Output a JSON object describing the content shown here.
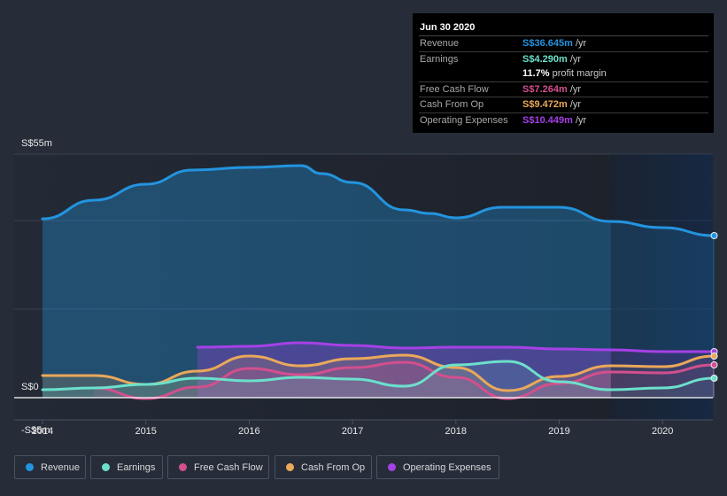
{
  "tooltip": {
    "date": "Jun 30 2020",
    "rows": [
      {
        "label": "Revenue",
        "value": "S$36.645m",
        "unit": " /yr",
        "color": "#2394df"
      },
      {
        "label": "Earnings",
        "value": "S$4.290m",
        "unit": " /yr",
        "color": "#6ce0cb"
      },
      {
        "label": "",
        "value": "11.7%",
        "unit": " profit margin",
        "color": "#ffffff"
      },
      {
        "label": "Free Cash Flow",
        "value": "S$7.264m",
        "unit": " /yr",
        "color": "#d34f8e"
      },
      {
        "label": "Cash From Op",
        "value": "S$9.472m",
        "unit": " /yr",
        "color": "#eaa85a"
      },
      {
        "label": "Operating Expenses",
        "value": "S$10.449m",
        "unit": " /yr",
        "color": "#a541e6"
      }
    ]
  },
  "legend": [
    {
      "label": "Revenue",
      "color": "#2394df"
    },
    {
      "label": "Earnings",
      "color": "#6ce0cb"
    },
    {
      "label": "Free Cash Flow",
      "color": "#d34f8e"
    },
    {
      "label": "Cash From Op",
      "color": "#eaa85a"
    },
    {
      "label": "Operating Expenses",
      "color": "#a541e6"
    }
  ],
  "chart_data": {
    "type": "area",
    "title": "",
    "xlabel": "",
    "ylabel": "",
    "currency_unit": "S$m",
    "ylim": [
      -5,
      55
    ],
    "xlim": [
      2013.7,
      2020.5
    ],
    "y_tick_labels": [
      {
        "value": 55,
        "label": "S$55m"
      },
      {
        "value": 0,
        "label": "S$0"
      },
      {
        "value": -5,
        "label": "-S$5m"
      }
    ],
    "x_tick_labels": [
      "2014",
      "2015",
      "2016",
      "2017",
      "2018",
      "2019",
      "2020"
    ],
    "x_ticks": [
      2014,
      2015,
      2016,
      2017,
      2018,
      2019,
      2020
    ],
    "gridlines": [
      20,
      40,
      55
    ],
    "highlight_range": [
      2019.5,
      2020.5
    ],
    "series": [
      {
        "name": "Revenue",
        "color": "#2394df",
        "points": [
          [
            2014.0,
            40.4
          ],
          [
            2014.5,
            44.6
          ],
          [
            2015.0,
            48.2
          ],
          [
            2015.45,
            51.4
          ],
          [
            2016.0,
            52.0
          ],
          [
            2016.5,
            52.4
          ],
          [
            2016.7,
            50.6
          ],
          [
            2017.0,
            48.6
          ],
          [
            2017.5,
            42.4
          ],
          [
            2017.75,
            41.6
          ],
          [
            2018.0,
            40.6
          ],
          [
            2018.45,
            43.0
          ],
          [
            2019.0,
            43.0
          ],
          [
            2019.5,
            39.8
          ],
          [
            2020.0,
            38.4
          ],
          [
            2020.5,
            36.6
          ]
        ]
      },
      {
        "name": "Operating Expenses",
        "color": "#a541e6",
        "points": [
          [
            2015.5,
            11.4
          ],
          [
            2016.0,
            11.6
          ],
          [
            2016.5,
            12.4
          ],
          [
            2017.0,
            11.8
          ],
          [
            2017.5,
            11.2
          ],
          [
            2018.0,
            11.4
          ],
          [
            2018.5,
            11.4
          ],
          [
            2019.0,
            11.0
          ],
          [
            2019.5,
            10.8
          ],
          [
            2020.0,
            10.4
          ],
          [
            2020.5,
            10.4
          ]
        ]
      },
      {
        "name": "Cash From Op",
        "color": "#eaa85a",
        "points": [
          [
            2014.0,
            5.0
          ],
          [
            2014.5,
            5.0
          ],
          [
            2015.0,
            3.0
          ],
          [
            2015.5,
            6.0
          ],
          [
            2016.0,
            9.4
          ],
          [
            2016.5,
            7.2
          ],
          [
            2017.0,
            8.8
          ],
          [
            2017.5,
            9.6
          ],
          [
            2018.0,
            6.8
          ],
          [
            2018.5,
            1.6
          ],
          [
            2019.0,
            4.8
          ],
          [
            2019.5,
            7.2
          ],
          [
            2020.0,
            7.0
          ],
          [
            2020.5,
            9.4
          ]
        ]
      },
      {
        "name": "Free Cash Flow",
        "color": "#d34f8e",
        "points": [
          [
            2014.5,
            2.2
          ],
          [
            2015.0,
            -0.2
          ],
          [
            2015.5,
            2.4
          ],
          [
            2016.0,
            6.6
          ],
          [
            2016.5,
            5.2
          ],
          [
            2017.0,
            6.8
          ],
          [
            2017.5,
            8.0
          ],
          [
            2018.0,
            4.6
          ],
          [
            2018.5,
            -0.2
          ],
          [
            2019.0,
            3.2
          ],
          [
            2019.5,
            5.8
          ],
          [
            2020.0,
            5.6
          ],
          [
            2020.5,
            7.4
          ]
        ]
      },
      {
        "name": "Earnings",
        "color": "#6ce0cb",
        "points": [
          [
            2014.0,
            1.8
          ],
          [
            2014.5,
            2.2
          ],
          [
            2015.0,
            3.0
          ],
          [
            2015.5,
            4.4
          ],
          [
            2016.0,
            3.8
          ],
          [
            2016.5,
            4.6
          ],
          [
            2017.0,
            4.2
          ],
          [
            2017.5,
            2.6
          ],
          [
            2018.0,
            7.4
          ],
          [
            2018.5,
            8.2
          ],
          [
            2019.0,
            3.6
          ],
          [
            2019.5,
            1.8
          ],
          [
            2020.0,
            2.2
          ],
          [
            2020.5,
            4.4
          ]
        ]
      }
    ]
  }
}
